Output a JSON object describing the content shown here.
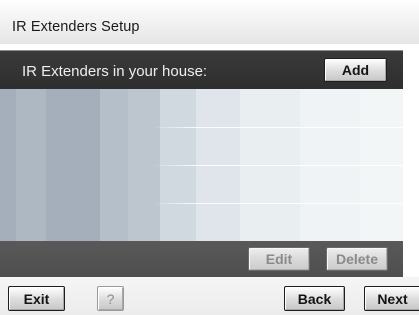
{
  "title": "IR Extenders Setup",
  "header": {
    "label": "IR Extenders in your house:",
    "add_label": "Add"
  },
  "list": {
    "rows": [
      "",
      "",
      "",
      ""
    ]
  },
  "actions": {
    "edit_label": "Edit",
    "delete_label": "Delete"
  },
  "nav": {
    "exit_label": "Exit",
    "help_label": "?",
    "back_label": "Back",
    "next_label": "Next"
  }
}
